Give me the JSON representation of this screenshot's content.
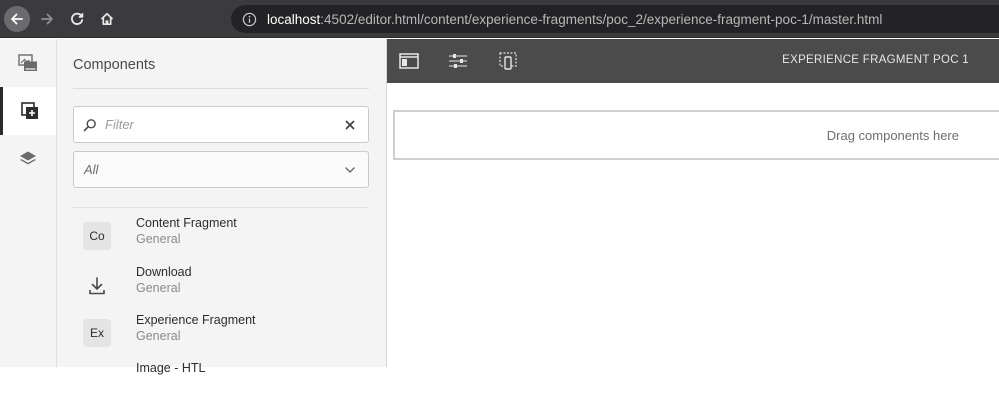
{
  "browser": {
    "url_host": "localhost",
    "url_rest": ":4502/editor.html/content/experience-fragments/poc_2/experience-fragment-poc-1/master.html",
    "icons": [
      "back-arrow-icon",
      "forward-arrow-icon",
      "reload-icon",
      "home-icon",
      "info-icon"
    ]
  },
  "rail": {
    "icons": [
      "assets-icon",
      "components-icon",
      "layers-icon"
    ],
    "active": "components-icon"
  },
  "panel": {
    "title": "Components",
    "filter_placeholder": "Filter",
    "group_value": "All",
    "items": [
      {
        "badge": "Co",
        "name": "Content Fragment",
        "group": "General"
      },
      {
        "badge": "",
        "icon": "download-icon",
        "name": "Download",
        "group": "General"
      },
      {
        "badge": "Ex",
        "name": "Experience Fragment",
        "group": "General"
      },
      {
        "name": "Image - HTL"
      }
    ]
  },
  "editor": {
    "toolbar_icons": [
      "toggle-side-panel-icon",
      "page-properties-icon",
      "emulator-icon"
    ],
    "title": "EXPERIENCE FRAGMENT POC 1",
    "drop_text": "Drag components here"
  },
  "colors": {
    "browser_bar": "#3b3b3d",
    "url_field": "#232325",
    "toolbar": "#4b4b4b",
    "panel_bg": "#f4f4f4"
  }
}
